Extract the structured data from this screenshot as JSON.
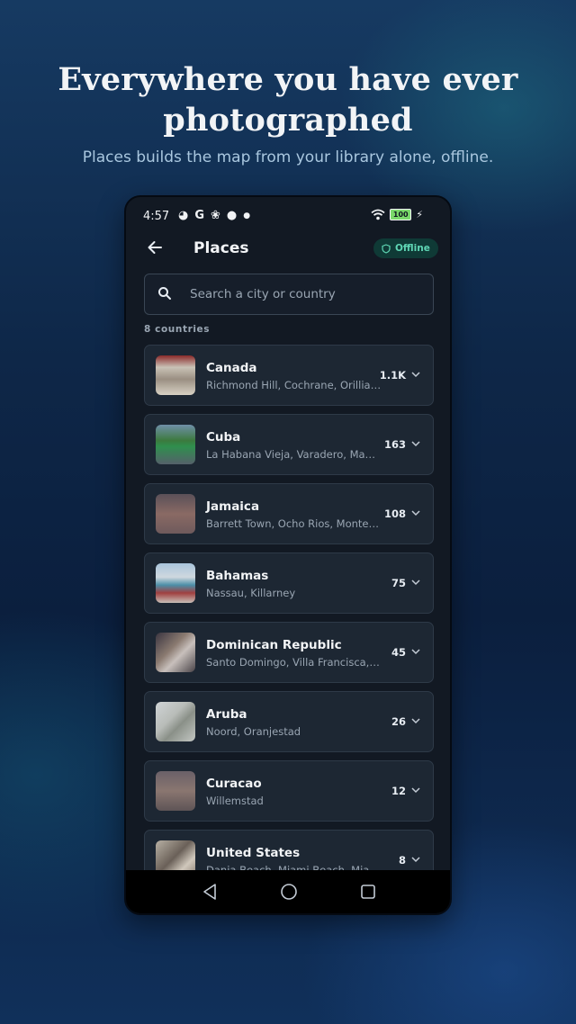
{
  "headline": "Everywhere you have ever photographed",
  "subline": "Places builds the map from your library alone, offline.",
  "status_bar": {
    "time": "4:57",
    "icons": [
      "app-icon",
      "google-icon",
      "fan-icon",
      "keyhole-icon",
      "dot-icon"
    ],
    "battery": "100"
  },
  "app": {
    "title": "Places",
    "offline_badge": "Offline",
    "search_placeholder": "Search a city or country",
    "count_label": "8 countries"
  },
  "countries": [
    {
      "name": "Canada",
      "places": "Richmond Hill, Cochrane, Orillia ...",
      "count": "1.1K"
    },
    {
      "name": "Cuba",
      "places": "La Habana Vieja, Varadero, Manti...",
      "count": "163"
    },
    {
      "name": "Jamaica",
      "places": "Barrett Town, Ocho Rios, Monteg...",
      "count": "108"
    },
    {
      "name": "Bahamas",
      "places": "Nassau, Killarney",
      "count": "75"
    },
    {
      "name": "Dominican Republic",
      "places": "Santo Domingo, Villa Francisca, La...",
      "count": "45"
    },
    {
      "name": "Aruba",
      "places": "Noord, Oranjestad",
      "count": "26"
    },
    {
      "name": "Curacao",
      "places": "Willemstad",
      "count": "12"
    },
    {
      "name": "United States",
      "places": "Dania Beach, Miami Beach, Miami...",
      "count": "8"
    }
  ],
  "colors": {
    "accent": "#5fd6b4",
    "card_bg": "#1d2733",
    "screen_bg": "#121923"
  }
}
